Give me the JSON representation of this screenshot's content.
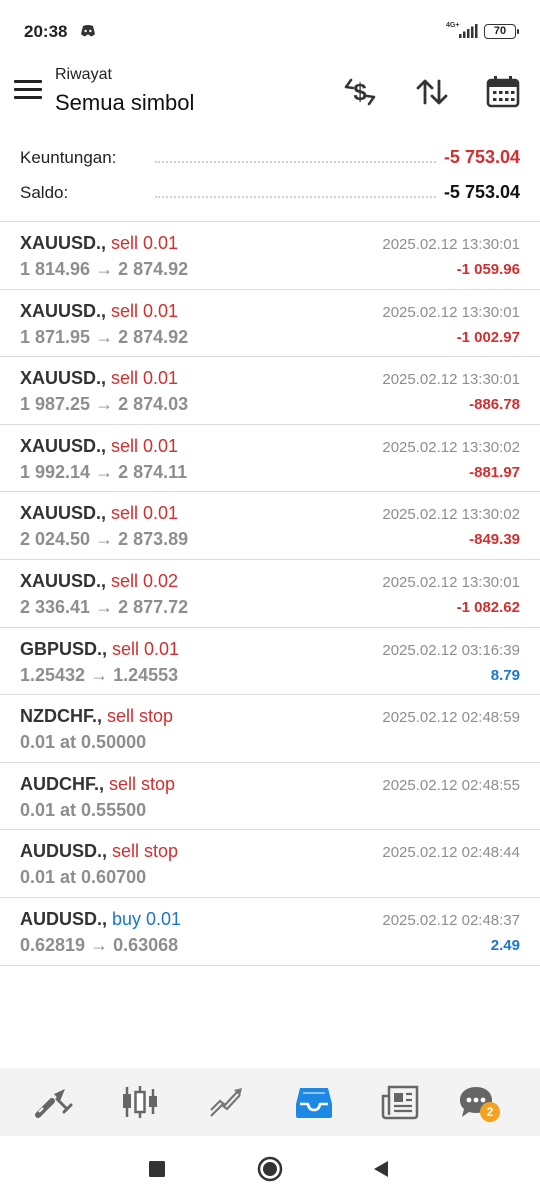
{
  "status_bar": {
    "time": "20:38",
    "network": "4G+",
    "battery": "70"
  },
  "header": {
    "subtitle": "Riwayat",
    "title": "Semua simbol",
    "icons": [
      "currency-exchange-icon",
      "sort-icon",
      "calendar-icon"
    ]
  },
  "summary": {
    "profit_label": "Keuntungan:",
    "profit_value": "-5 753.04",
    "balance_label": "Saldo:",
    "balance_value": "-5 753.04"
  },
  "trades": [
    {
      "symbol": "XAUUSD.,",
      "action": " sell 0.01",
      "type": "sell",
      "prices": "1 814.96 → 2 874.92",
      "time": "2025.02.12 13:30:01",
      "profit": "-1 059.96",
      "sign": "neg"
    },
    {
      "symbol": "XAUUSD.,",
      "action": " sell 0.01",
      "type": "sell",
      "prices": "1 871.95 → 2 874.92",
      "time": "2025.02.12 13:30:01",
      "profit": "-1 002.97",
      "sign": "neg"
    },
    {
      "symbol": "XAUUSD.,",
      "action": " sell 0.01",
      "type": "sell",
      "prices": "1 987.25 → 2 874.03",
      "time": "2025.02.12 13:30:01",
      "profit": "-886.78",
      "sign": "neg"
    },
    {
      "symbol": "XAUUSD.,",
      "action": " sell 0.01",
      "type": "sell",
      "prices": "1 992.14 → 2 874.11",
      "time": "2025.02.12 13:30:02",
      "profit": "-881.97",
      "sign": "neg"
    },
    {
      "symbol": "XAUUSD.,",
      "action": " sell 0.01",
      "type": "sell",
      "prices": "2 024.50 → 2 873.89",
      "time": "2025.02.12 13:30:02",
      "profit": "-849.39",
      "sign": "neg"
    },
    {
      "symbol": "XAUUSD.,",
      "action": " sell 0.02",
      "type": "sell",
      "prices": "2 336.41 → 2 877.72",
      "time": "2025.02.12 13:30:01",
      "profit": "-1 082.62",
      "sign": "neg"
    },
    {
      "symbol": "GBPUSD.,",
      "action": " sell 0.01",
      "type": "sell",
      "prices": "1.25432 → 1.24553",
      "time": "2025.02.12 03:16:39",
      "profit": "8.79",
      "sign": "pos"
    },
    {
      "symbol": "NZDCHF.,",
      "action": " sell stop",
      "type": "sell",
      "prices": "0.01 at 0.50000",
      "time": "2025.02.12 02:48:59",
      "profit": "",
      "sign": "none"
    },
    {
      "symbol": "AUDCHF.,",
      "action": " sell stop",
      "type": "sell",
      "prices": "0.01 at 0.55500",
      "time": "2025.02.12 02:48:55",
      "profit": "",
      "sign": "none"
    },
    {
      "symbol": "AUDUSD.,",
      "action": " sell stop",
      "type": "sell",
      "prices": "0.01 at 0.60700",
      "time": "2025.02.12 02:48:44",
      "profit": "",
      "sign": "none"
    },
    {
      "symbol": "AUDUSD.,",
      "action": " buy 0.01",
      "type": "buy",
      "prices": "0.62819 → 0.63068",
      "time": "2025.02.12 02:48:37",
      "profit": "2.49",
      "sign": "pos"
    }
  ],
  "bottom_nav": {
    "items": [
      "quotes-icon",
      "chart-icon",
      "trade-icon",
      "history-icon",
      "news-icon",
      "chat-icon"
    ],
    "active": "history-icon",
    "chat_badge": "2"
  },
  "colors": {
    "negative": "#d32f2f",
    "positive": "#1976d2",
    "accent": "#1e88e5",
    "badge": "#f4a224"
  }
}
